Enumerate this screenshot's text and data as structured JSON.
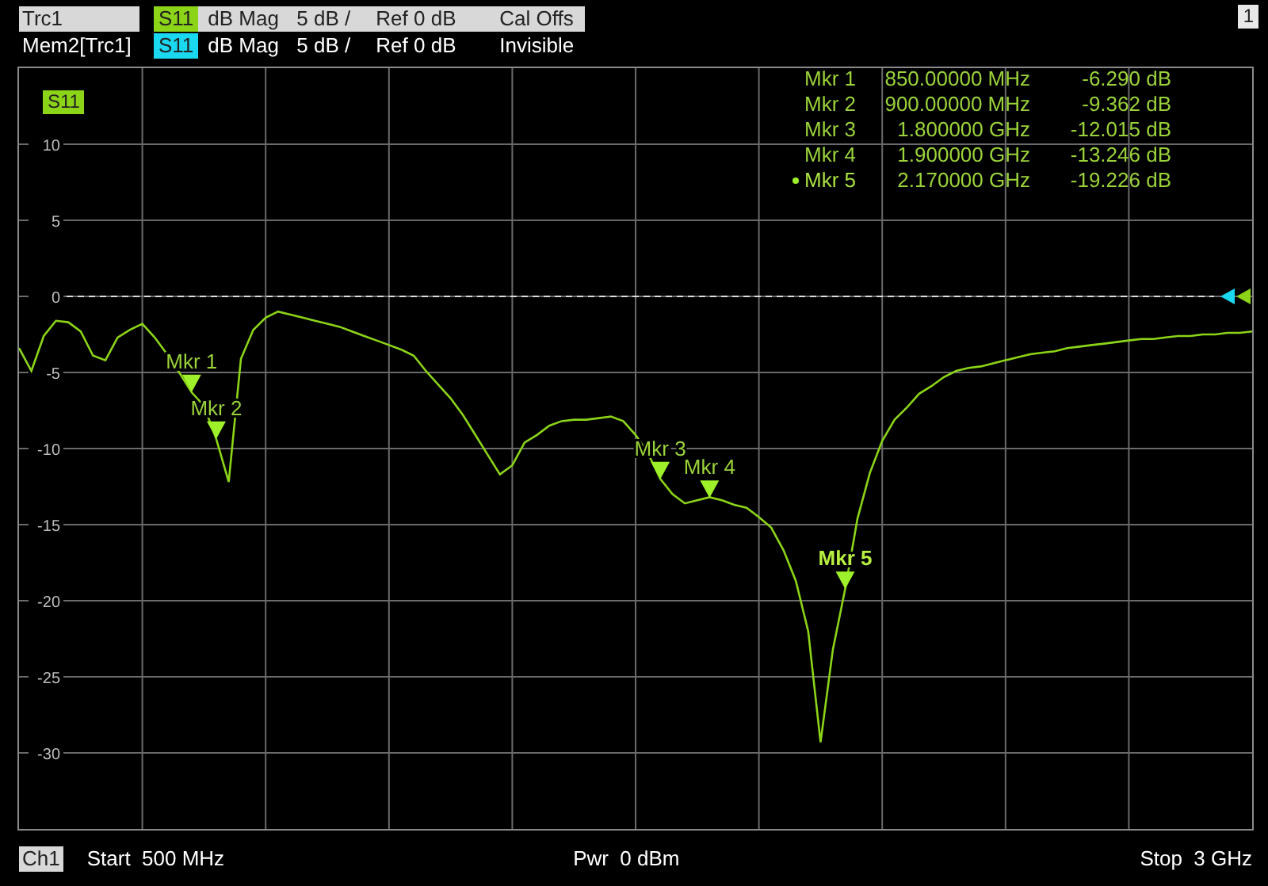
{
  "traces": [
    {
      "name": "Trc1",
      "parameter": "S11",
      "color": "#8cd418",
      "format": "dB Mag",
      "scale": "5 dB /",
      "reference": "Ref 0 dB",
      "status": "Cal Offs",
      "selected": true
    },
    {
      "name": "Mem2[Trc1]",
      "parameter": "S11",
      "color": "#1ad8f0",
      "format": "dB Mag",
      "scale": "5 dB /",
      "reference": "Ref 0 dB",
      "status": "Invisible",
      "selected": false
    }
  ],
  "window_number": "1",
  "diagram": {
    "chart_data": {
      "type": "line",
      "categories": [
        null,
        null,
        null,
        null,
        null,
        null,
        null,
        null,
        null,
        null,
        null,
        null,
        null,
        null,
        null,
        null,
        null,
        null,
        null,
        null,
        null,
        null,
        null,
        null,
        null,
        null,
        null,
        null,
        null,
        null,
        null,
        null,
        null,
        null,
        null,
        null,
        null,
        null,
        null,
        null,
        null,
        null,
        null,
        null,
        null,
        null,
        null,
        null,
        null,
        null,
        null,
        null,
        null,
        null,
        null,
        null,
        null,
        null,
        null,
        null,
        null,
        null,
        null,
        null,
        null,
        null,
        null,
        null,
        null,
        null,
        null,
        null,
        null,
        null,
        null,
        null,
        null,
        null,
        null,
        null,
        null,
        null,
        null,
        null,
        null,
        null,
        null,
        null,
        null,
        null,
        null,
        null,
        null,
        null,
        null,
        null,
        null,
        null,
        null,
        null,
        null
      ],
      "series": [
        {
          "name": "S11",
          "color": "#8cd418",
          "values": [
            -3.4,
            -4.9,
            -2.6,
            -1.6,
            -1.7,
            -2.3,
            -3.9,
            -4.2,
            -2.7,
            -2.2,
            -1.8,
            -2.7,
            -3.8,
            -5.0,
            -6.3,
            -7.2,
            -9.4,
            -12.2,
            -4.1,
            -2.2,
            -1.4,
            -1.0,
            -1.2,
            -1.4,
            -1.6,
            -1.8,
            -2.0,
            -2.3,
            -2.6,
            -2.9,
            -3.2,
            -3.5,
            -3.9,
            -4.9,
            -5.8,
            -6.7,
            -7.8,
            -9.1,
            -10.4,
            -11.7,
            -11.1,
            -9.6,
            -9.1,
            -8.5,
            -8.2,
            -8.1,
            -8.1,
            -8.0,
            -7.9,
            -8.2,
            -9.1,
            -10.3,
            -12.0,
            -13.0,
            -13.6,
            -13.4,
            -13.2,
            -13.4,
            -13.7,
            -13.9,
            -14.5,
            -15.2,
            -16.7,
            -18.7,
            -22.0,
            -29.3,
            -23.2,
            -19.2,
            -14.6,
            -11.6,
            -9.5,
            -8.1,
            -7.3,
            -6.4,
            -5.9,
            -5.3,
            -4.9,
            -4.7,
            -4.6,
            -4.4,
            -4.2,
            -4.0,
            -3.8,
            -3.7,
            -3.6,
            -3.4,
            -3.3,
            -3.2,
            -3.1,
            -3.0,
            -2.9,
            -2.8,
            -2.8,
            -2.7,
            -2.6,
            -2.6,
            -2.5,
            -2.5,
            -2.4,
            -2.4,
            -2.3
          ]
        }
      ],
      "ylim": [
        -35,
        15
      ],
      "grid": true,
      "ref_lines": [
        {
          "axis": "y",
          "value": 0
        }
      ],
      "yticks": [
        {
          "value": 10,
          "label": "10"
        },
        {
          "value": 5,
          "label": "5"
        },
        {
          "value": 0,
          "label": "0"
        },
        {
          "value": -5,
          "label": "-5"
        },
        {
          "value": -10,
          "label": "-10"
        },
        {
          "value": -15,
          "label": "-15"
        },
        {
          "value": -20,
          "label": "-20"
        },
        {
          "value": -25,
          "label": "-25"
        },
        {
          "value": -30,
          "label": "-30"
        }
      ],
      "annotations": [
        {
          "text": "Mkr 1",
          "y": -6.29
        },
        {
          "text": "Mkr 2",
          "y": -9.362
        },
        {
          "text": "Mkr 3",
          "y": -12.015
        },
        {
          "text": "Mkr 4",
          "y": -13.246
        },
        {
          "text": "Mkr 5",
          "y": -19.226
        }
      ]
    },
    "marker_table": [
      {
        "name": "Mkr 1",
        "stimulus": "850.00000 MHz",
        "response": "-6.290 dB",
        "selected": false
      },
      {
        "name": "Mkr 2",
        "stimulus": "900.00000 MHz",
        "response": "-9.362 dB",
        "selected": false
      },
      {
        "name": "Mkr 3",
        "stimulus": "1.800000 GHz",
        "response": "-12.015 dB",
        "selected": false
      },
      {
        "name": "Mkr 4",
        "stimulus": "1.900000 GHz",
        "response": "-13.246 dB",
        "selected": false
      },
      {
        "name": "Mkr 5",
        "stimulus": "2.170000 GHz",
        "response": "-19.226 dB",
        "selected": true
      }
    ]
  },
  "status_bar": {
    "channel": "Ch1",
    "start": "Start  500 MHz",
    "power": "Pwr  0 dBm",
    "stop": "Stop  3 GHz"
  }
}
